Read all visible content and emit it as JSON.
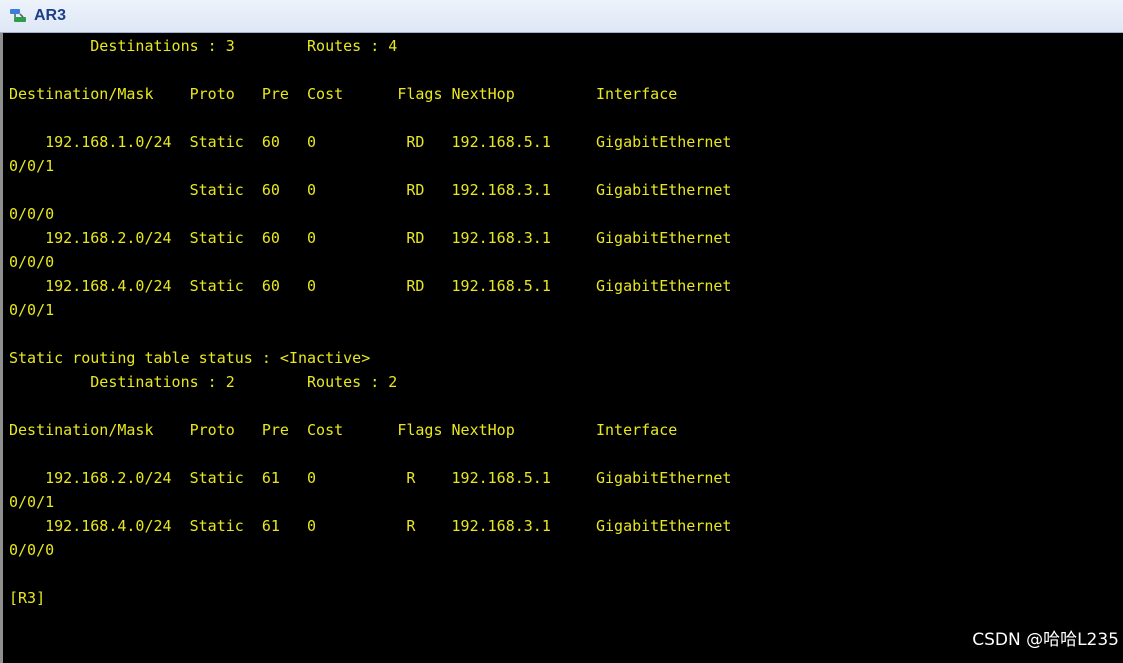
{
  "window": {
    "title": "AR3",
    "icon": "network-device-icon"
  },
  "terminal": {
    "lines": [
      "         Destinations : 3        Routes : 4",
      "",
      "Destination/Mask    Proto   Pre  Cost      Flags NextHop         Interface",
      "",
      "    192.168.1.0/24  Static  60   0          RD   192.168.5.1     GigabitEthernet",
      "0/0/1",
      "                    Static  60   0          RD   192.168.3.1     GigabitEthernet",
      "0/0/0",
      "    192.168.2.0/24  Static  60   0          RD   192.168.3.1     GigabitEthernet",
      "0/0/0",
      "    192.168.4.0/24  Static  60   0          RD   192.168.5.1     GigabitEthernet",
      "0/0/1",
      "",
      "Static routing table status : <Inactive>",
      "         Destinations : 2        Routes : 2",
      "",
      "Destination/Mask    Proto   Pre  Cost      Flags NextHop         Interface",
      "",
      "    192.168.2.0/24  Static  61   0          R    192.168.5.1     GigabitEthernet",
      "0/0/1",
      "    192.168.4.0/24  Static  61   0          R    192.168.3.1     GigabitEthernet",
      "0/0/0",
      "",
      "[R3]"
    ],
    "text_color": "#e8e820",
    "background_color": "#000000"
  },
  "watermark": {
    "text": "CSDN @哈哈L235"
  }
}
